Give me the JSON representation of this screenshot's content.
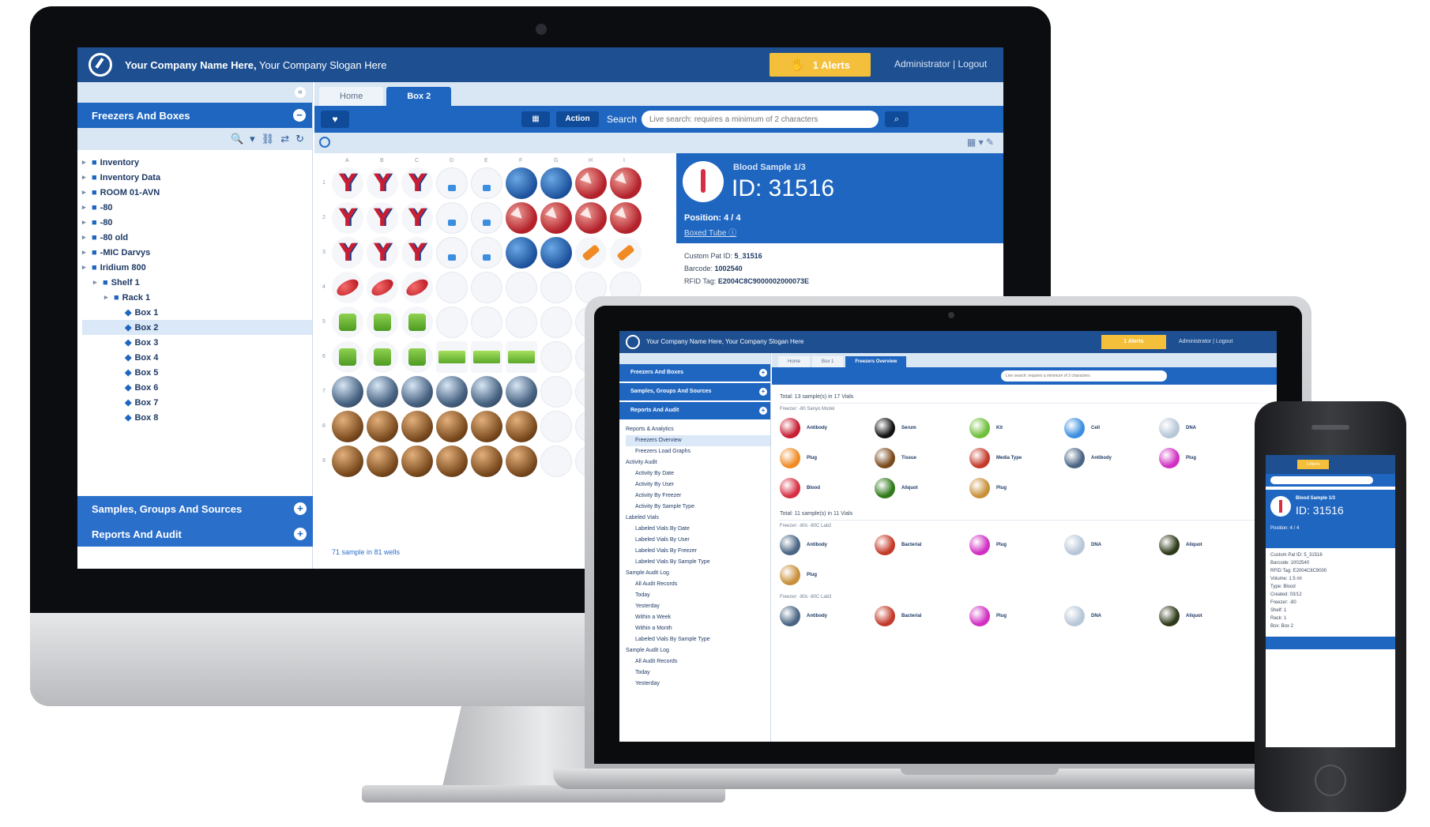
{
  "desktop": {
    "company_name": "Your Company Name Here,",
    "company_slogan": "Your Company Slogan Here",
    "alerts_label": "1 Alerts",
    "admin_label": "Administrator | Logout",
    "sidebar": {
      "freezers_header": "Freezers And Boxes",
      "samples_header": "Samples, Groups And Sources",
      "reports_header": "Reports And Audit",
      "tree": [
        {
          "label": "Inventory",
          "level": 0
        },
        {
          "label": "Inventory Data",
          "level": 0
        },
        {
          "label": "ROOM 01-AVN",
          "level": 0
        },
        {
          "label": "-80",
          "level": 0
        },
        {
          "label": "-80",
          "level": 0
        },
        {
          "label": "-80 old",
          "level": 0
        },
        {
          "label": "-MIC Darvys",
          "level": 0
        },
        {
          "label": "Iridium 800",
          "level": 0
        },
        {
          "label": "Shelf 1",
          "level": 1
        },
        {
          "label": "Rack 1",
          "level": 2
        },
        {
          "label": "Box 1",
          "level": 3
        },
        {
          "label": "Box 2",
          "level": 3,
          "selected": true
        },
        {
          "label": "Box 3",
          "level": 3
        },
        {
          "label": "Box 4",
          "level": 3
        },
        {
          "label": "Box 5",
          "level": 3
        },
        {
          "label": "Box 6",
          "level": 3
        },
        {
          "label": "Box 7",
          "level": 3
        },
        {
          "label": "Box 8",
          "level": 3
        }
      ]
    },
    "tabs": [
      "Home",
      "Box 2"
    ],
    "active_tab": "Box 2",
    "toolbar": {
      "action_label": "Action",
      "search_label": "Search",
      "search_placeholder": "Live search: requires a minimum of 2 characters"
    },
    "grid": {
      "columns": [
        "A",
        "B",
        "C",
        "D",
        "E",
        "F",
        "G",
        "H",
        "I"
      ],
      "rows": [
        "1",
        "2",
        "3",
        "4",
        "5",
        "6",
        "7",
        "8",
        "9"
      ],
      "cells": [
        [
          "y",
          "y",
          "y",
          "vial",
          "vial",
          "blue",
          "blue",
          "red",
          "red"
        ],
        [
          "y",
          "y",
          "y",
          "vial",
          "vial",
          "red",
          "red",
          "red",
          "red"
        ],
        [
          "y",
          "y",
          "y",
          "vial",
          "vial",
          "blue",
          "blue",
          "orange",
          "orange"
        ],
        [
          "pill",
          "pill",
          "pill",
          "empty",
          "empty",
          "empty",
          "empty",
          "empty",
          "empty"
        ],
        [
          "green",
          "green",
          "green",
          "empty",
          "empty",
          "empty",
          "empty",
          "empty",
          "empty"
        ],
        [
          "green",
          "green",
          "green",
          "greenbar",
          "greenbar",
          "greenbar",
          "empty",
          "empty",
          "empty"
        ],
        [
          "steel",
          "steel",
          "steel",
          "steel",
          "steel",
          "steel",
          "empty",
          "empty",
          "empty"
        ],
        [
          "bronze",
          "bronze",
          "bronze",
          "bronze",
          "bronze",
          "bronze",
          "empty",
          "empty",
          "empty"
        ],
        [
          "bronze",
          "bronze",
          "bronze",
          "bronze",
          "bronze",
          "bronze",
          "empty",
          "empty",
          "empty"
        ]
      ],
      "footer": "71 sample in 81 wells"
    },
    "detail": {
      "sample_type": "Blood Sample 1/3",
      "sample_id": "ID: 31516",
      "position": "Position: 4 / 4",
      "link": "Boxed Tube ⓘ",
      "lines": [
        {
          "key": "Custom Pat ID:",
          "value": "5_31516"
        },
        {
          "key": "Barcode:",
          "value": "1002540"
        },
        {
          "key": "RFID Tag:",
          "value": "E2004C8C9000002000073E"
        }
      ]
    }
  },
  "laptop": {
    "company": "Your Company Name Here, Your Company Slogan Here",
    "alerts_label": "1 Alerts",
    "admin_label": "Administrator | Logout",
    "sidebar_headers": [
      "Freezers And Boxes",
      "Samples, Groups And Sources",
      "Reports And Audit"
    ],
    "tree": [
      {
        "label": "Reports & Analytics",
        "level": 0
      },
      {
        "label": "Freezers Overview",
        "level": 1,
        "selected": true
      },
      {
        "label": "Freezers Load Graphs",
        "level": 1
      },
      {
        "label": "Activity Audit",
        "level": 0
      },
      {
        "label": "Activity By Date",
        "level": 1
      },
      {
        "label": "Activity By User",
        "level": 1
      },
      {
        "label": "Activity By Freezer",
        "level": 1
      },
      {
        "label": "Activity By Sample Type",
        "level": 1
      },
      {
        "label": "Labeled Vials",
        "level": 0
      },
      {
        "label": "Labeled Vials By Date",
        "level": 1
      },
      {
        "label": "Labeled Vials By User",
        "level": 1
      },
      {
        "label": "Labeled Vials By Freezer",
        "level": 1
      },
      {
        "label": "Labeled Vials By Sample Type",
        "level": 1
      },
      {
        "label": "Sample Audit Log",
        "level": 0
      },
      {
        "label": "All Audit Records",
        "level": 1
      },
      {
        "label": "Today",
        "level": 1
      },
      {
        "label": "Yesterday",
        "level": 1
      },
      {
        "label": "Within a Week",
        "level": 1
      },
      {
        "label": "Within a Month",
        "level": 1
      },
      {
        "label": "Labeled Vials By Sample Type",
        "level": 1
      },
      {
        "label": "Sample Audit Log",
        "level": 0
      },
      {
        "label": "All Audit Records",
        "level": 1
      },
      {
        "label": "Today",
        "level": 1
      },
      {
        "label": "Yesterday",
        "level": 1
      }
    ],
    "tabs": [
      "Home",
      "Box 1",
      "Freezers Overview"
    ],
    "active_tab": "Freezers Overview",
    "search_placeholder": "Live search: requires a minimum of 2 characters",
    "sections": [
      {
        "title": "Total: 13 sample(s) in 17 Vials",
        "freezer": "Freezer: -80 Sanyo Model",
        "items": [
          {
            "name": "Antibody",
            "color": "#c81e33"
          },
          {
            "name": "Serum",
            "color": "#121212"
          },
          {
            "name": "Kit",
            "color": "#6fbf3a"
          },
          {
            "name": "Cell",
            "color": "#3b8ee0"
          },
          {
            "name": "DNA",
            "color": "#b8c7d8"
          },
          {
            "name": "Plug",
            "color": "#f08a24"
          },
          {
            "name": "Tissue",
            "color": "#7a4a1e"
          },
          {
            "name": "Media Type",
            "color": "#c43a2a"
          },
          {
            "name": "Antibody",
            "color": "#4a6584"
          },
          {
            "name": "Plug",
            "color": "#d12fc2"
          },
          {
            "name": "Blood",
            "color": "#d62f43"
          },
          {
            "name": "Aliquot",
            "color": "#2f7a1a"
          },
          {
            "name": "Plug",
            "color": "#c8903a"
          }
        ]
      },
      {
        "title": "Total: 11 sample(s) in 11 Vials",
        "freezer": "Freezer: -80c -80C Lab2",
        "items": [
          {
            "name": "Antibody",
            "color": "#4a6584"
          },
          {
            "name": "Bacterial",
            "color": "#c43a2a"
          },
          {
            "name": "Plug",
            "color": "#d12fc2"
          },
          {
            "name": "DNA",
            "color": "#b8c7d8"
          },
          {
            "name": "Aliquot",
            "color": "#2f3a1a"
          },
          {
            "name": "Plug",
            "color": "#c8903a"
          }
        ]
      },
      {
        "title": "",
        "freezer": "Freezer: -80c -80C Lab3",
        "items": [
          {
            "name": "Antibody",
            "color": "#4a6584"
          },
          {
            "name": "Bacterial",
            "color": "#c43a2a"
          },
          {
            "name": "Plug",
            "color": "#d12fc2"
          },
          {
            "name": "DNA",
            "color": "#b8c7d8"
          },
          {
            "name": "Aliquot",
            "color": "#2f3a1a"
          }
        ]
      }
    ]
  },
  "phone": {
    "alerts_label": "1 Alerts",
    "sample_type": "Blood Sample 1/3",
    "sample_id": "ID: 31516",
    "position": "Position: 4 / 4",
    "lines": [
      "Custom Pat ID: 5_31516",
      "Barcode: 1002540",
      "RFID Tag: E2004C8C9000",
      "Volume: 1.5 ml",
      "Type: Blood",
      "Created: 03/12",
      "Freezer: -80",
      "Shelf: 1",
      "Rack: 1",
      "Box: Box 2"
    ]
  },
  "colors": {
    "brand_navy": "#1d4f91",
    "brand_blue": "#1f66c1",
    "alert_yellow": "#f4bf3a",
    "panel_light": "#d9e6f4"
  }
}
